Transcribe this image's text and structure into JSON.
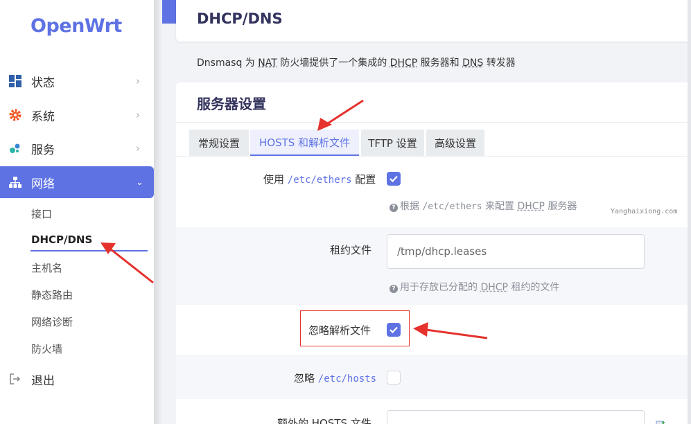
{
  "logo": "OpenWrt",
  "sidebar": {
    "items": [
      {
        "label": "状态",
        "icon": "dashboard-icon"
      },
      {
        "label": "系统",
        "icon": "gear-icon"
      },
      {
        "label": "服务",
        "icon": "puzzle-icon"
      },
      {
        "label": "网络",
        "icon": "network-icon"
      }
    ],
    "network_sub": [
      "接口",
      "DHCP/DNS",
      "主机名",
      "静态路由",
      "网络诊断",
      "防火墙"
    ],
    "logout": "退出"
  },
  "page": {
    "title": "DHCP/DNS",
    "desc": {
      "p1": "Dnsmasq 为 ",
      "nat": "NAT",
      "p2": " 防火墙提供了一个集成的 ",
      "dhcp": "DHCP",
      "p3": " 服务器和 ",
      "dns": "DNS",
      "p4": " 转发器"
    }
  },
  "section": {
    "title": "服务器设置",
    "tabs": [
      "常规设置",
      "HOSTS 和解析文件",
      "TFTP 设置",
      "高级设置"
    ],
    "active_tab": "HOSTS 和解析文件"
  },
  "fields": {
    "ethers": {
      "label_pre": "使用 ",
      "label_code": "/etc/ethers",
      "label_post": " 配置",
      "checked": true,
      "help_pre": "根据 ",
      "help_code": "/etc/ethers",
      "help_mid": " 来配置 ",
      "help_abbr": "DHCP",
      "help_post": " 服务器"
    },
    "leasefile": {
      "label": "租约文件",
      "value": "/tmp/dhcp.leases",
      "help_pre": "用于存放已分配的 ",
      "help_abbr": "DHCP",
      "help_post": " 租约的文件"
    },
    "noresolv": {
      "label": "忽略解析文件",
      "checked": true
    },
    "nohosts": {
      "label_pre": "忽略 ",
      "label_code": "/etc/hosts",
      "checked": false
    },
    "addnhosts": {
      "label": "额外的 HOSTS 文件",
      "value": ""
    }
  },
  "watermark": "Yanghaixiong.com",
  "colors": {
    "accent": "#5e72e4",
    "annotation": "#e5322d"
  }
}
